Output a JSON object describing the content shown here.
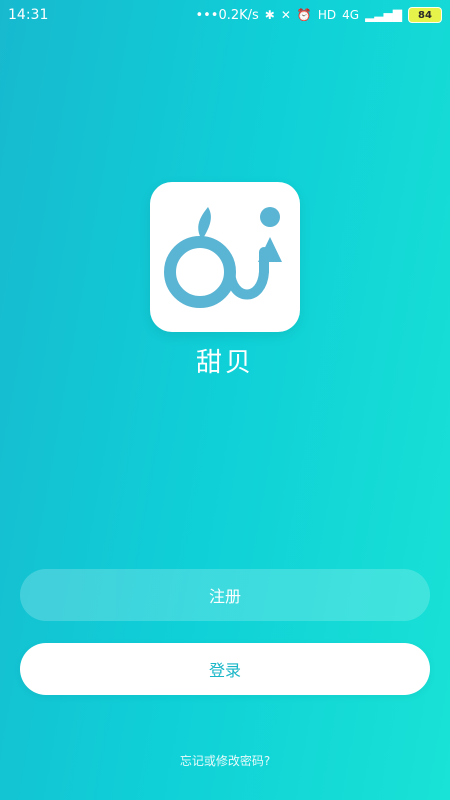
{
  "status_bar": {
    "time": "14:31",
    "network_speed": "•••0.2K/s",
    "network_type": "4G",
    "hd_label": "HD",
    "battery": "84",
    "icons": [
      "bluetooth-icon",
      "mute-icon",
      "alarm-icon",
      "hd-icon",
      "signal-icon",
      "battery-icon"
    ]
  },
  "app": {
    "name": "甜贝",
    "logo_color": "#5ab4d3"
  },
  "buttons": {
    "register": "注册",
    "login": "登录"
  },
  "links": {
    "forgot": "忘记或修改密码?"
  }
}
